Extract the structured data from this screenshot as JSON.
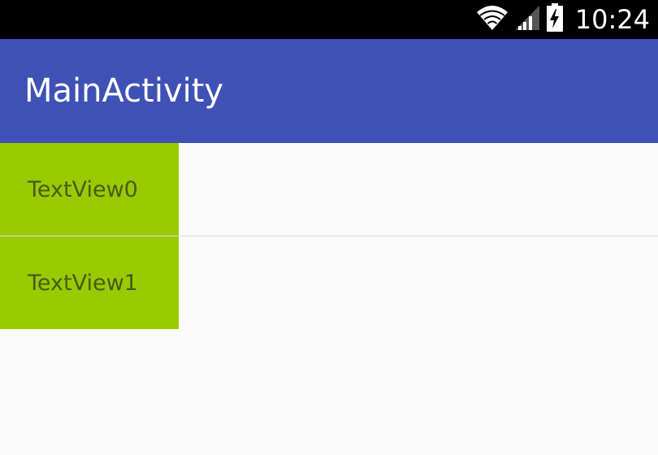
{
  "status_bar": {
    "time": "10:24",
    "icons": [
      "wifi-icon",
      "signal-icon",
      "battery-charging-icon"
    ]
  },
  "app_bar": {
    "title": "MainActivity",
    "color": "#3f51b5"
  },
  "list": {
    "items": [
      {
        "label": "TextView0"
      },
      {
        "label": "TextView1"
      }
    ],
    "item_color": "#99cc00"
  }
}
